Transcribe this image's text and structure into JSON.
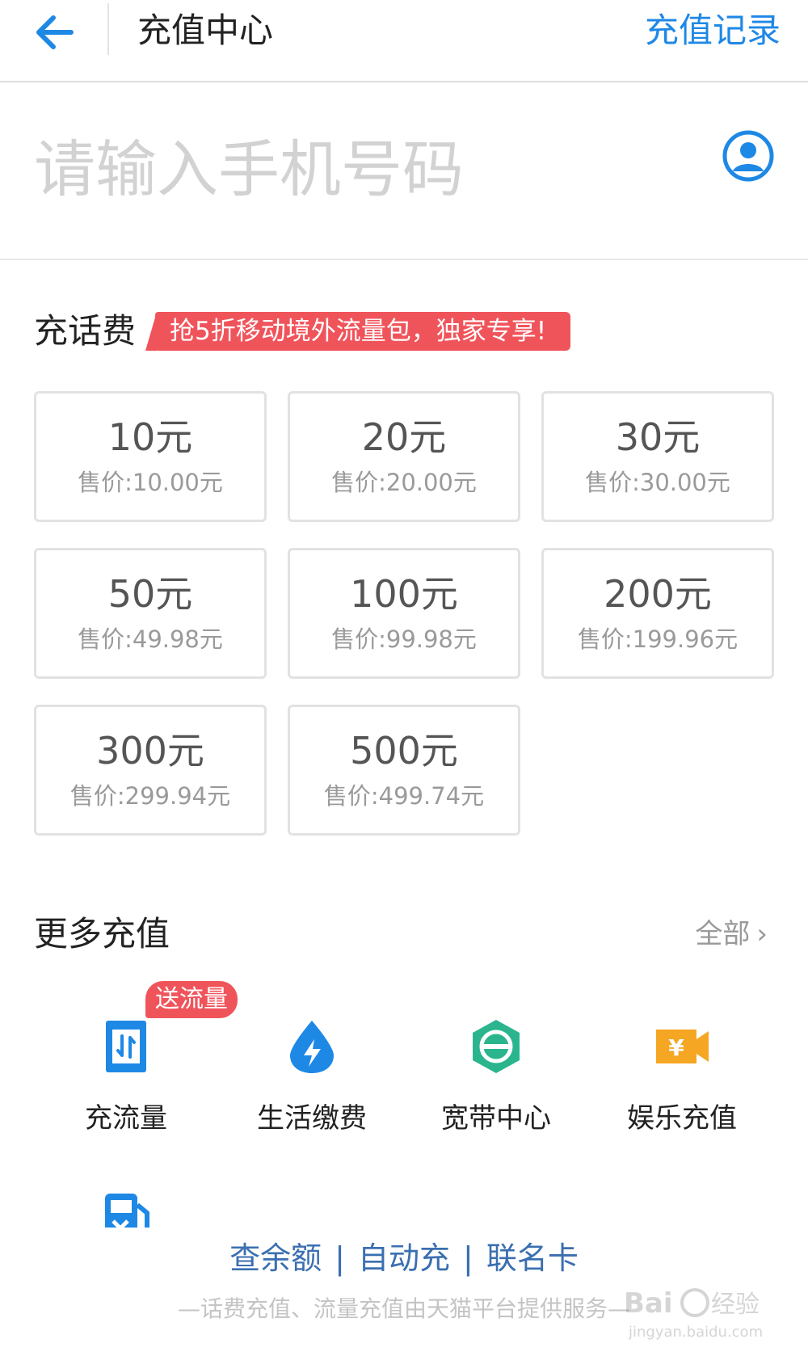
{
  "header": {
    "title": "充值中心",
    "history_label": "充值记录"
  },
  "phone": {
    "placeholder": "请输入手机号码",
    "value": ""
  },
  "topup": {
    "title": "充话费",
    "promo": "抢5折移动境外流量包，独家专享!",
    "options": [
      {
        "amount": "10元",
        "price": "售价:10.00元"
      },
      {
        "amount": "20元",
        "price": "售价:20.00元"
      },
      {
        "amount": "30元",
        "price": "售价:30.00元"
      },
      {
        "amount": "50元",
        "price": "售价:49.98元"
      },
      {
        "amount": "100元",
        "price": "售价:99.98元"
      },
      {
        "amount": "200元",
        "price": "售价:199.96元"
      },
      {
        "amount": "300元",
        "price": "售价:299.94元"
      },
      {
        "amount": "500元",
        "price": "售价:499.74元"
      }
    ]
  },
  "more": {
    "title": "更多充值",
    "all_label": "全部",
    "badge": "送流量",
    "services": [
      {
        "label": "充流量",
        "icon": "data-flow-icon"
      },
      {
        "label": "生活缴费",
        "icon": "water-bolt-icon"
      },
      {
        "label": "宽带中心",
        "icon": "broadband-icon"
      },
      {
        "label": "娱乐充值",
        "icon": "entertainment-icon"
      }
    ],
    "partial_icon": "fuel-icon"
  },
  "footer": {
    "links": [
      "查余额",
      "自动充",
      "联名卡"
    ],
    "separator": "|",
    "note": "—话费充值、流量充值由天猫平台提供服务—",
    "watermark": "Baidu经验 jingyan.baidu.com"
  },
  "colors": {
    "accent": "#1e88e5",
    "promo": "#f0545b",
    "card_border": "#e2e2e2",
    "link": "#3b6fb0"
  }
}
